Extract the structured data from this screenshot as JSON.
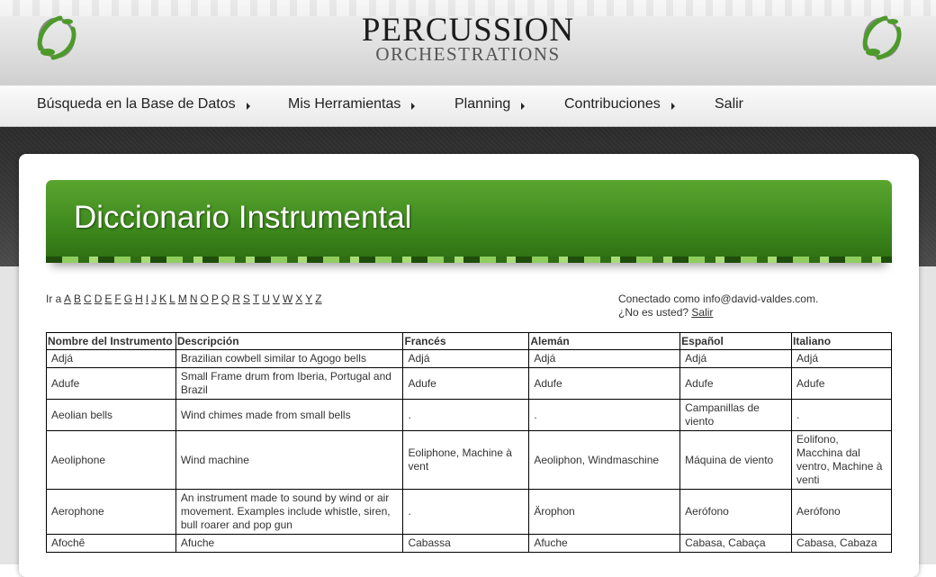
{
  "header": {
    "title": "PERCUSSION",
    "subtitle": "ORCHESTRATIONS"
  },
  "nav": [
    {
      "label": "Búsqueda en la Base de Datos",
      "has_arrow": true
    },
    {
      "label": "Mis Herramientas",
      "has_arrow": true
    },
    {
      "label": "Planning",
      "has_arrow": true
    },
    {
      "label": "Contribuciones",
      "has_arrow": true
    },
    {
      "label": "Salir",
      "has_arrow": false
    }
  ],
  "page": {
    "title": "Diccionario Instrumental"
  },
  "alphabet": {
    "prefix": "Ir a",
    "letters": [
      "A",
      "B",
      "C",
      "D",
      "E",
      "F",
      "G",
      "H",
      "I",
      "J",
      "K",
      "L",
      "M",
      "N",
      "O",
      "P",
      "Q",
      "R",
      "S",
      "T",
      "U",
      "V",
      "W",
      "X",
      "Y",
      "Z"
    ]
  },
  "login": {
    "connected_text": "Conectado como info@david-valdes.com.",
    "question": "¿No es usted?",
    "logout_link": "Salir"
  },
  "table": {
    "headers": [
      "Nombre del Instrumento",
      "Descripción",
      "Francés",
      "Alemán",
      "Español",
      "Italiano"
    ],
    "rows": [
      [
        "Adjá",
        "Brazilian cowbell similar to Agogo bells",
        "Adjá",
        "Adjá",
        "Adjá",
        "Adjá"
      ],
      [
        "Adufe",
        "Small Frame drum from Iberia, Portugal and Brazil",
        "Adufe",
        "Adufe",
        "Adufe",
        "Adufe"
      ],
      [
        "Aeolian bells",
        "Wind chimes made from small bells",
        ".",
        ".",
        "Campanillas de viento",
        "."
      ],
      [
        "Aeoliphone",
        "Wind machine",
        "Eoliphone, Machine à vent",
        "Aeoliphon, Windmaschine",
        "Máquina de viento",
        "Eolifono, Macchina dal ventro, Machine à venti"
      ],
      [
        "Aerophone",
        "An instrument made to sound by wind or air movement. Examples include whistle, siren, bull roarer and pop gun",
        ".",
        "Ärophon",
        "Aerófono",
        "Aerófono"
      ],
      [
        "Afochê",
        "Afuche",
        "Cabassa",
        "Afuche",
        "Cabasa, Cabaça",
        "Cabasa, Cabaza"
      ]
    ]
  },
  "colors": {
    "banner_green": "#3f8a1e",
    "logo_green": "#4c9a2a"
  }
}
